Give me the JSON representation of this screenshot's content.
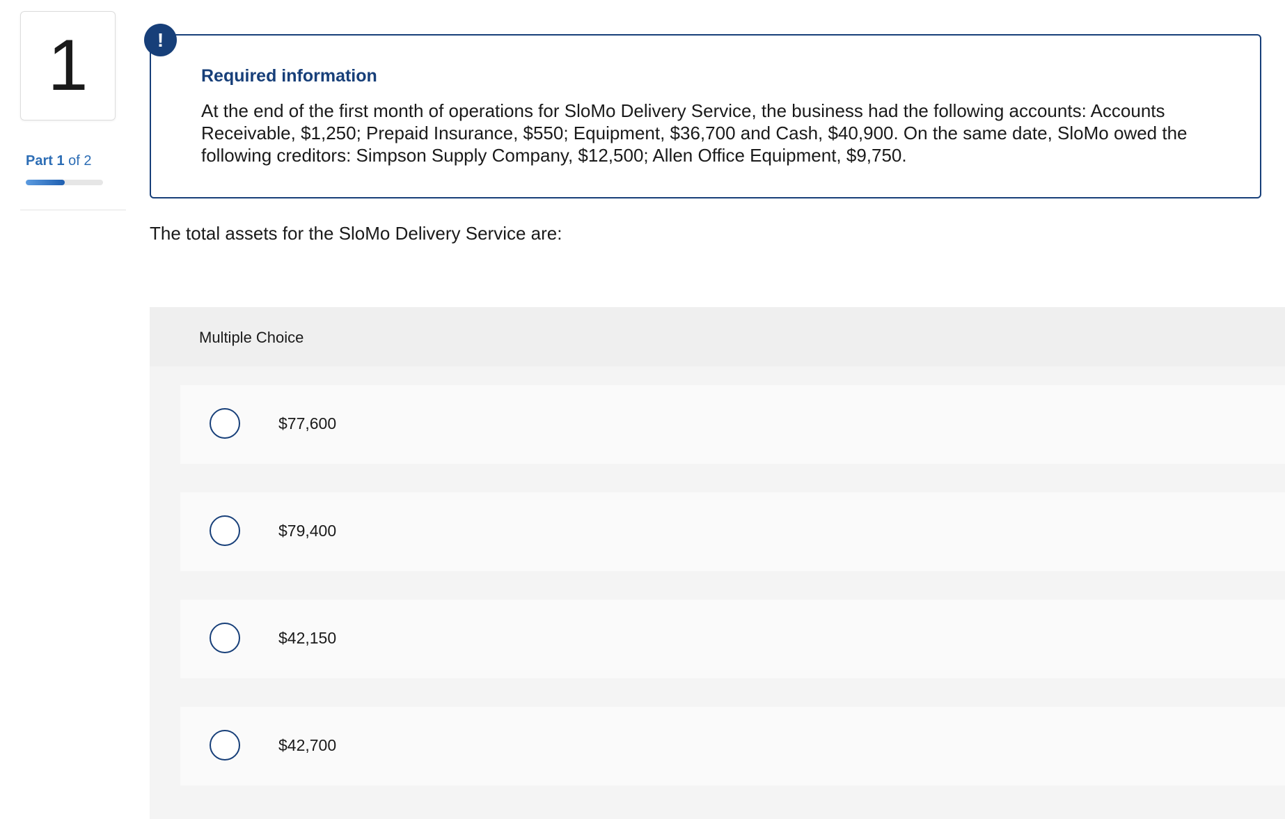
{
  "question": {
    "number": "1",
    "part_label_prefix": "Part",
    "part_current": "1",
    "part_of_text": "of 2",
    "part_progress": 0.5
  },
  "info": {
    "badge": "!",
    "title": "Required information",
    "text": "At the end of the first month of operations for SloMo Delivery Service, the business had the following accounts: Accounts Receivable, $1,250; Prepaid Insurance, $550; Equipment, $36,700 and Cash, $40,900. On the same date, SloMo owed the following creditors: Simpson Supply Company, $12,500; Allen Office Equipment, $9,750."
  },
  "prompt": "The total assets for the SloMo Delivery Service are:",
  "multiple_choice": {
    "header": "Multiple Choice",
    "options": [
      {
        "label": "$77,600"
      },
      {
        "label": "$79,400"
      },
      {
        "label": "$42,150"
      },
      {
        "label": "$42,700"
      }
    ]
  },
  "colors": {
    "accent": "#173f79",
    "part_text": "#2c6db5"
  }
}
